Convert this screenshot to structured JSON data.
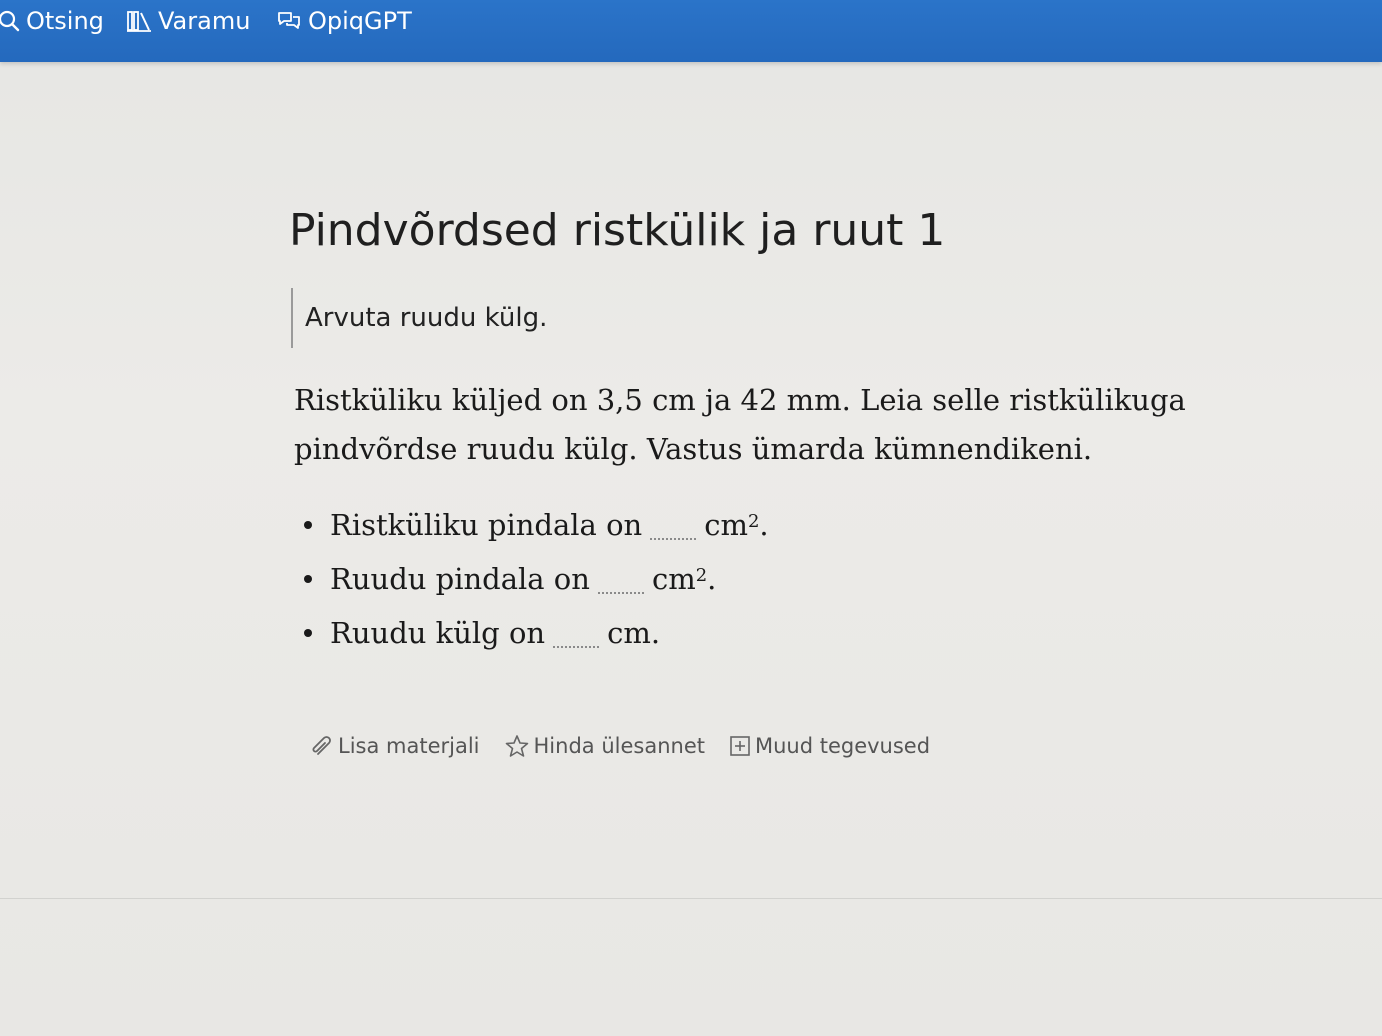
{
  "nav": {
    "search_label": "Otsing",
    "library_label": "Varamu",
    "gpt_label": "OpiqGPT"
  },
  "task": {
    "title": "Pindvõrdsed ristkülik ja ruut 1",
    "instruction": "Arvuta ruudu külg.",
    "problem_line1": "Ristküliku küljed on 3,5 cm ja 42 mm. Leia selle ristkülikuga",
    "problem_line2": "pindvõrdse ruudu külg. Vastus ümarda kümnendikeni.",
    "answers": [
      {
        "prefix": "Ristküliku pindala on",
        "unit": "cm",
        "exponent": "2",
        "suffix": ".",
        "value": ""
      },
      {
        "prefix": "Ruudu pindala on",
        "unit": "cm",
        "exponent": "2",
        "suffix": ".",
        "value": ""
      },
      {
        "prefix": "Ruudu külg on",
        "unit": "cm.",
        "exponent": "",
        "suffix": "",
        "value": ""
      }
    ]
  },
  "actions": {
    "add_material": "Lisa materjali",
    "rate_task": "Hinda ülesannet",
    "other_actions": "Muud tegevused"
  },
  "colors": {
    "topbar": "#2a71c5",
    "page_background": "#e9e8e5"
  },
  "icons": {
    "search": "search-icon",
    "library": "library-icon",
    "gpt": "chat-icon",
    "add_material": "paperclip-icon",
    "rate": "star-icon",
    "more": "plus-box-icon"
  }
}
